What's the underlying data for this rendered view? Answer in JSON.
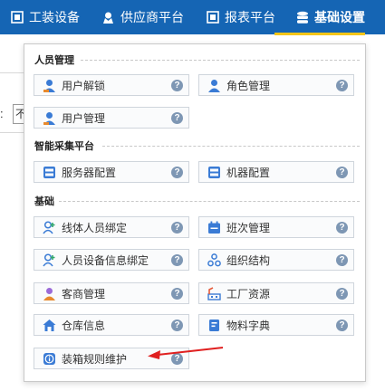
{
  "navbar": {
    "items": [
      {
        "label": "工装设备",
        "icon": "clipboard-icon"
      },
      {
        "label": "供应商平台",
        "icon": "user-badge-icon"
      },
      {
        "label": "报表平台",
        "icon": "report-icon"
      },
      {
        "label": "基础设置",
        "icon": "database-icon"
      }
    ],
    "active_index": 3,
    "bg_color": "#1565b4",
    "active_underline_color": "#f5c518"
  },
  "background": {
    "field_label": ":",
    "field_value": "不"
  },
  "dropdown": {
    "sections": [
      {
        "title": "人员管理",
        "items": [
          {
            "label": "用户解锁",
            "icon": "user-icon"
          },
          {
            "label": "角色管理",
            "icon": "user-group-icon"
          },
          {
            "label": "用户管理",
            "icon": "user-icon"
          }
        ]
      },
      {
        "title": "智能采集平台",
        "items": [
          {
            "label": "服务器配置",
            "icon": "server-icon"
          },
          {
            "label": "机器配置",
            "icon": "machine-icon"
          }
        ]
      },
      {
        "title": "基础",
        "items": [
          {
            "label": "线体人员绑定",
            "icon": "user-add-icon"
          },
          {
            "label": "班次管理",
            "icon": "calendar-icon"
          },
          {
            "label": "人员设备信息绑定",
            "icon": "user-add-icon"
          },
          {
            "label": "组织结构",
            "icon": "org-chart-icon"
          },
          {
            "label": "客商管理",
            "icon": "merchant-icon"
          },
          {
            "label": "工厂资源",
            "icon": "factory-icon"
          },
          {
            "label": "仓库信息",
            "icon": "warehouse-icon"
          },
          {
            "label": "物料字典",
            "icon": "dictionary-icon"
          },
          {
            "label": "装箱规则维护",
            "icon": "info-icon"
          }
        ]
      }
    ],
    "help_glyph": "?"
  },
  "annotation": {
    "arrow_color": "#e02020"
  }
}
